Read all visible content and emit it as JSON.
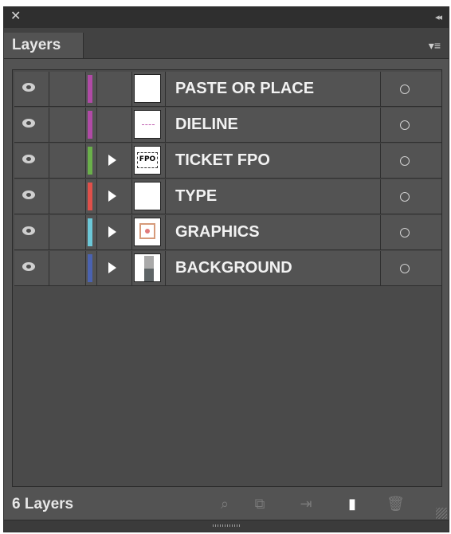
{
  "titlebar": {
    "close_glyph": "✕",
    "collapse_glyph": "◂◂"
  },
  "panel": {
    "tab_label": "Layers",
    "menu_glyph": "▾≡"
  },
  "layers": [
    {
      "name": "PASTE OR PLACE",
      "color": "#b04aa6",
      "expandable": false,
      "thumbnail": "blank"
    },
    {
      "name": "DIELINE",
      "color": "#b04aa6",
      "expandable": false,
      "thumbnail": "dieline"
    },
    {
      "name": "TICKET FPO",
      "color": "#6ab04a",
      "expandable": true,
      "thumbnail": "fpo",
      "thumb_text": "FPO"
    },
    {
      "name": "TYPE",
      "color": "#e0504a",
      "expandable": true,
      "thumbnail": "blank"
    },
    {
      "name": "GRAPHICS",
      "color": "#6cc8d8",
      "expandable": true,
      "thumbnail": "graphic"
    },
    {
      "name": "BACKGROUND",
      "color": "#4a62b0",
      "expandable": true,
      "thumbnail": "background"
    }
  ],
  "footer": {
    "count_label": "6 Layers",
    "buttons": [
      "search-icon",
      "make-clipping-mask-icon",
      "move-to-layer-icon",
      "new-layer-icon",
      "trash-icon"
    ]
  }
}
